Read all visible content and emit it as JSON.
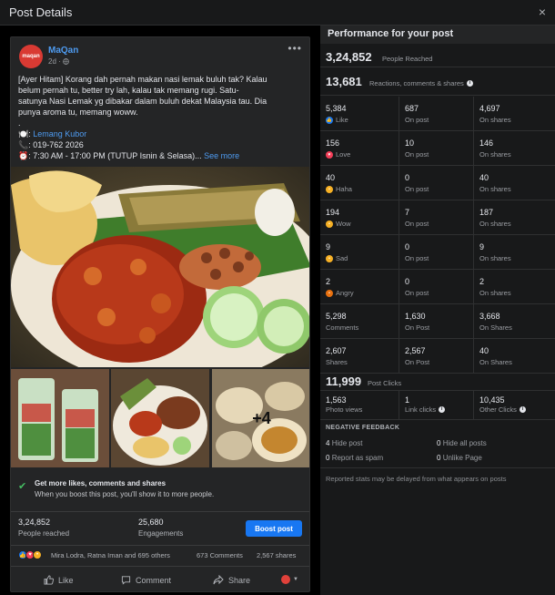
{
  "dialog": {
    "title": "Post Details",
    "close_icon": "×"
  },
  "post": {
    "avatar_text": "maqan",
    "author": "MaQan",
    "time": "2d · ",
    "privacy_icon": "globe-icon",
    "more_icon": "•••",
    "caption": {
      "line1": "[Ayer Hitam] Korang dah pernah makan nasi lemak buluh tak? Kalau",
      "line2": "belum pernah tu, better try lah, kalau tak memang rugi. Satu-",
      "line3": "satunya Nasi Lemak yg dibakar dalam buluh dekat Malaysia tau. Dia",
      "line4": "punya aroma tu, memang woww.",
      "line5": ".",
      "place_prefix": "🍽️: ",
      "place": "Lemang Kubor",
      "phone": "📞: 019-762 2026",
      "hours": "⏰: 7:30 AM - 17:00 PM (TUTUP Isnin & Selasa)...",
      "see_more": " See more"
    },
    "more_photos": "+4",
    "boost_tip": {
      "title": "Get more likes, comments and shares",
      "subtitle": "When you boost this post, you'll show it to more people."
    },
    "reached_num": "3,24,852",
    "reached_lbl": "People reached",
    "engagements_num": "25,680",
    "engagements_lbl": "Engagements",
    "boost_button": "Boost post",
    "reaction_names": "Mira Lodra, Ratna Iman and 695 others",
    "comments_count": "673 Comments",
    "shares_count": "2,567 shares",
    "actions": {
      "like": "Like",
      "comment": "Comment",
      "share": "Share"
    }
  },
  "panel": {
    "title": "Performance for your post",
    "reached": {
      "num": "3,24,852",
      "label": "People Reached"
    },
    "reactions_total": {
      "num": "13,681",
      "label": "Reactions, comments & shares"
    },
    "rows": [
      {
        "v1": "5,384",
        "l1": "Like",
        "emo": "like",
        "v2": "687",
        "l2": "On post",
        "v3": "4,697",
        "l3": "On shares"
      },
      {
        "v1": "156",
        "l1": "Love",
        "emo": "love",
        "v2": "10",
        "l2": "On post",
        "v3": "146",
        "l3": "On shares"
      },
      {
        "v1": "40",
        "l1": "Haha",
        "emo": "haha",
        "v2": "0",
        "l2": "On post",
        "v3": "40",
        "l3": "On shares"
      },
      {
        "v1": "194",
        "l1": "Wow",
        "emo": "wow",
        "v2": "7",
        "l2": "On post",
        "v3": "187",
        "l3": "On shares"
      },
      {
        "v1": "9",
        "l1": "Sad",
        "emo": "sad",
        "v2": "0",
        "l2": "On post",
        "v3": "9",
        "l3": "On shares"
      },
      {
        "v1": "2",
        "l1": "Angry",
        "emo": "angry",
        "v2": "0",
        "l2": "On post",
        "v3": "2",
        "l3": "On shares"
      },
      {
        "v1": "5,298",
        "l1": "Comments",
        "emo": "",
        "v2": "1,630",
        "l2": "On Post",
        "v3": "3,668",
        "l3": "On Shares"
      },
      {
        "v1": "2,607",
        "l1": "Shares",
        "emo": "",
        "v2": "2,567",
        "l2": "On Post",
        "v3": "40",
        "l3": "On Shares"
      }
    ],
    "clicks": {
      "num": "11,999",
      "label": "Post Clicks"
    },
    "clicks_row": {
      "v1": "1,563",
      "l1": "Photo views",
      "v2": "1",
      "l2": "Link clicks",
      "v3": "10,435",
      "l3": "Other Clicks"
    },
    "negative": {
      "title": "NEGATIVE FEEDBACK",
      "hide_post_num": "4",
      "hide_post": "Hide post",
      "hide_all_num": "0",
      "hide_all": "Hide all posts",
      "spam_num": "0",
      "spam": "Report as spam",
      "unlike_num": "0",
      "unlike": "Unlike Page"
    },
    "footnote": "Reported stats may be delayed from what appears on posts"
  },
  "colors": {
    "accent": "#1877f2",
    "link": "#4e9bf0",
    "check": "#45bd62",
    "like": "#1877f2",
    "love": "#f33e58",
    "haha": "#f7b125",
    "angry": "#e9710f"
  }
}
